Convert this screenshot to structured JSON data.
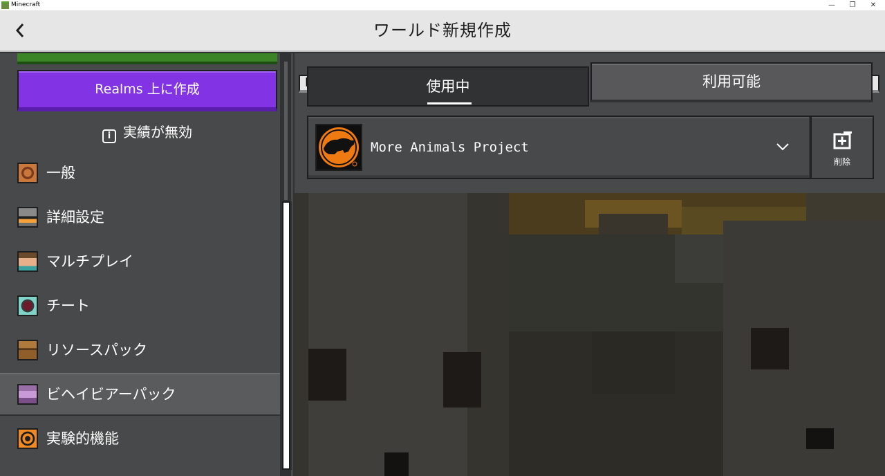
{
  "window": {
    "app_title": "Minecraft",
    "controls": {
      "minimize": "—",
      "restore": "❐",
      "close": "✕"
    }
  },
  "header": {
    "title": "ワールド新規作成",
    "back_icon": "chevron-left-icon"
  },
  "sidebar": {
    "realms_button": "Realms 上に作成",
    "achievements_notice": "実績が無効",
    "items": [
      {
        "label": "一般",
        "icon": "gear-block-icon"
      },
      {
        "label": "詳細設定",
        "icon": "furnace-icon"
      },
      {
        "label": "マルチプレイ",
        "icon": "player-head-icon"
      },
      {
        "label": "チート",
        "icon": "command-block-icon"
      },
      {
        "label": "リソースパック",
        "icon": "chest-icon"
      },
      {
        "label": "ビヘイビアーパック",
        "icon": "behavior-pack-icon"
      },
      {
        "label": "実験的機能",
        "icon": "experiment-icon"
      }
    ],
    "selected": "ビヘイビアーパック"
  },
  "tabs": {
    "left_bumper": "[",
    "right_bumper": "]",
    "active": "使用中",
    "inactive": "利用可能"
  },
  "pack": {
    "name": "More Animals Project",
    "icon": "bear-logo-icon",
    "expand_icon": "chevron-down-icon",
    "remove_label": "削除",
    "remove_icon": "remove-pack-icon"
  },
  "colors": {
    "realms_purple": "#8234e4",
    "create_green": "#3c8527",
    "panel_gray": "#48494a",
    "header_bg": "#e6e6e6"
  }
}
